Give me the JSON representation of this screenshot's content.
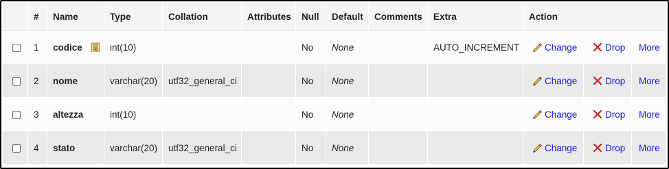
{
  "headers": {
    "num": "#",
    "name": "Name",
    "type": "Type",
    "collation": "Collation",
    "attributes": "Attributes",
    "null": "Null",
    "default": "Default",
    "comments": "Comments",
    "extra": "Extra",
    "action": "Action"
  },
  "rows": [
    {
      "num": "1",
      "name": "codice",
      "type": "int(10)",
      "collation": "",
      "attributes": "",
      "null": "No",
      "default": "None",
      "comments": "",
      "extra": "AUTO_INCREMENT"
    },
    {
      "num": "2",
      "name": "nome",
      "type": "varchar(20)",
      "collation": "utf32_general_ci",
      "attributes": "",
      "null": "No",
      "default": "None",
      "comments": "",
      "extra": ""
    },
    {
      "num": "3",
      "name": "altezza",
      "type": "int(10)",
      "collation": "",
      "attributes": "",
      "null": "No",
      "default": "None",
      "comments": "",
      "extra": ""
    },
    {
      "num": "4",
      "name": "stato",
      "type": "varchar(20)",
      "collation": "utf32_general_ci",
      "attributes": "",
      "null": "No",
      "default": "None",
      "comments": "",
      "extra": ""
    }
  ],
  "actions": {
    "change": "Change",
    "drop": "Drop",
    "more": "More"
  },
  "icons": {
    "primary_key": "primary-key-icon",
    "change": "pencil-icon",
    "drop": "x-icon"
  },
  "colors": {
    "link": "#1a1ad6",
    "header_bg": "#f4f4f4",
    "row_even_bg": "#e9e9e9",
    "drop_icon": "#cc2222"
  }
}
